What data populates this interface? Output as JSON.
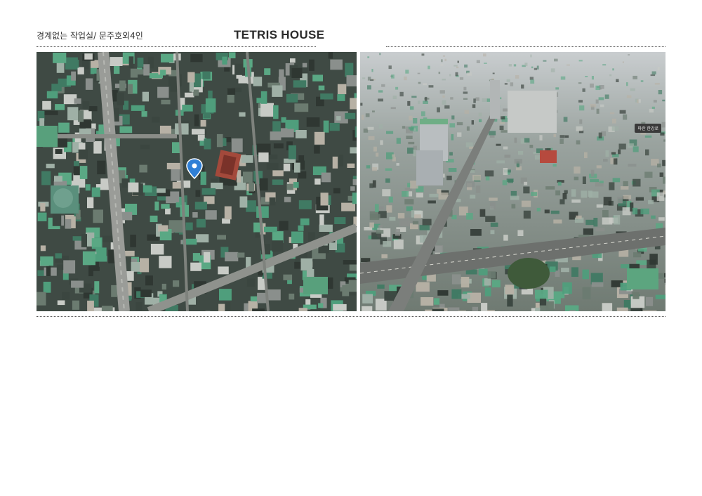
{
  "header": {
    "subtitle": "경계없는 작업실/ 문주호외4인",
    "title": "TETRIS HOUSE"
  },
  "photos": {
    "top_view": {
      "icon": "location-pin-icon"
    },
    "oblique_view": {
      "label": "파란 한강로"
    }
  },
  "colors": {
    "rule": "#555555",
    "roof_green": "#4f9e7c",
    "road": "#8d918e",
    "highlight_roof": "#a3493b"
  }
}
